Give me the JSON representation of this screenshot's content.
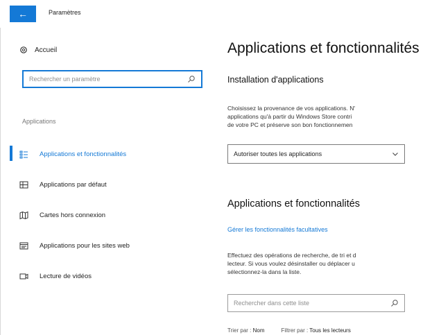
{
  "titlebar": {
    "back_icon": "back-arrow-icon",
    "title": "Paramètres"
  },
  "sidebar": {
    "home_label": "Accueil",
    "search_placeholder": "Rechercher un paramètre",
    "section_label": "Applications",
    "items": [
      {
        "label": "Applications et fonctionnalités",
        "icon": "apps-list-icon",
        "active": true
      },
      {
        "label": "Applications par défaut",
        "icon": "default-apps-icon",
        "active": false
      },
      {
        "label": "Cartes hors connexion",
        "icon": "map-icon",
        "active": false
      },
      {
        "label": "Applications pour les sites web",
        "icon": "website-apps-icon",
        "active": false
      },
      {
        "label": "Lecture de vidéos",
        "icon": "video-icon",
        "active": false
      }
    ]
  },
  "main": {
    "page_title": "Applications et fonctionnalités",
    "install_heading": "Installation d'applications",
    "install_text": [
      "Choisissez la provenance de vos applications. N'",
      "applications qu'à partir du Windows Store contri",
      "de votre PC et préserve son bon fonctionnemen"
    ],
    "install_select_value": "Autoriser toutes les applications",
    "apps_heading": "Applications et fonctionnalités",
    "optional_link": "Gérer les fonctionnalités facultatives",
    "apps_text": [
      "Effectuez des opérations de recherche, de tri et d",
      "lecteur. Si vous voulez désinstaller ou déplacer u",
      "sélectionnez-la dans la liste."
    ],
    "list_search_placeholder": "Rechercher dans cette liste",
    "sort_label": "Trier par :",
    "sort_value": "Nom",
    "filter_label": "Filtrer par :",
    "filter_value": "Tous les lecteurs"
  },
  "colors": {
    "accent": "#1479d6"
  }
}
